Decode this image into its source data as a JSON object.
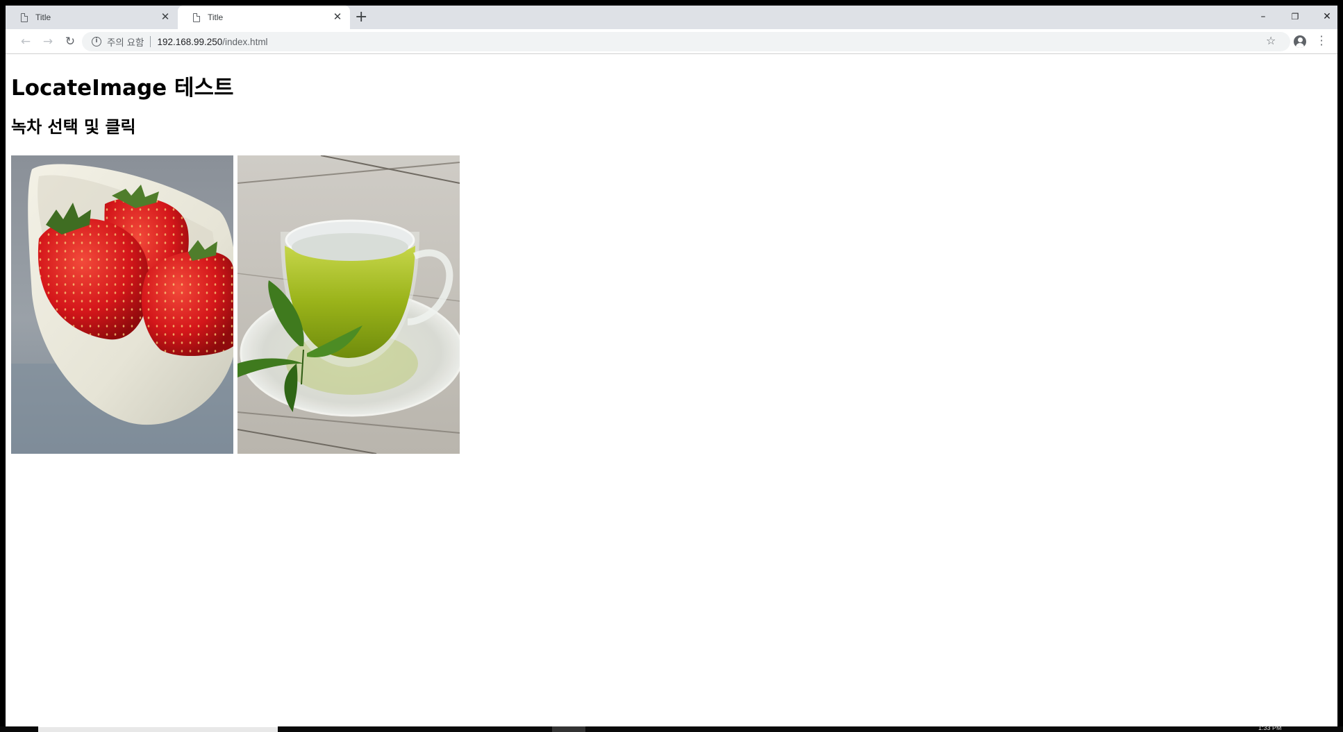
{
  "tabs": [
    {
      "title": "Title"
    },
    {
      "title": "Title"
    }
  ],
  "toolbar": {
    "security_label": "주의 요함",
    "url_host": "192.168.99.250",
    "url_path": "/index.html"
  },
  "page": {
    "title": "LocateImage 테스트",
    "subtitle": "녹차 선택 및 클릭"
  },
  "images": [
    {
      "name": "strawberry-image"
    },
    {
      "name": "greentea-image"
    }
  ],
  "taskbar": {
    "clock": "1:33 PM"
  }
}
